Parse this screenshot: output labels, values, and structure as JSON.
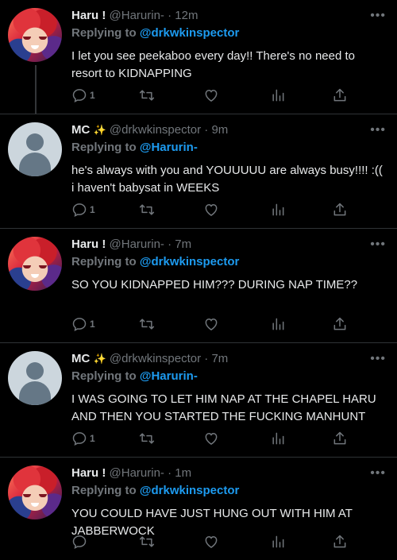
{
  "tweets": [
    {
      "name": "Haru !",
      "name_suffix": "",
      "handle": "@Harurin-",
      "time": "12m",
      "replying_label": "Replying to",
      "replying_handle": "@drkwkinspector",
      "text": "I let you see peekaboo every day!! There's no need to resort to KIDNAPPING",
      "reply_count": "1",
      "avatar": "haru"
    },
    {
      "name": "MC",
      "name_suffix": "✨",
      "handle": "@drkwkinspector",
      "time": "9m",
      "replying_label": "Replying to",
      "replying_handle": "@Harurin-",
      "text": "he's always with you and YOUUUUU are always busy!!!! :(( i haven't babysat in WEEKS",
      "reply_count": "1",
      "avatar": "mc"
    },
    {
      "name": "Haru !",
      "name_suffix": "",
      "handle": "@Harurin-",
      "time": "7m",
      "replying_label": "Replying to",
      "replying_handle": "@drkwkinspector",
      "text": "SO YOU KIDNAPPED HIM??? DURING NAP TIME??",
      "reply_count": "1",
      "avatar": "haru"
    },
    {
      "name": "MC",
      "name_suffix": "✨",
      "handle": "@drkwkinspector",
      "time": "7m",
      "replying_label": "Replying to",
      "replying_handle": "@Harurin-",
      "text": "I WAS GOING TO LET HIM NAP AT THE CHAPEL HARU AND THEN YOU STARTED THE FUCKING MANHUNT",
      "reply_count": "1",
      "avatar": "mc"
    },
    {
      "name": "Haru !",
      "name_suffix": "",
      "handle": "@Harurin-",
      "time": "1m",
      "replying_label": "Replying to",
      "replying_handle": "@drkwkinspector",
      "text": "YOU COULD HAVE JUST HUNG OUT WITH HIM AT JABBERWOCK",
      "reply_count": "",
      "avatar": "haru"
    }
  ],
  "separator": "·",
  "more_glyph": "•••",
  "icons": {
    "reply": "reply-icon",
    "retweet": "retweet-icon",
    "like": "heart-icon",
    "views": "analytics-icon",
    "share": "share-icon"
  },
  "colors": {
    "background": "#000000",
    "link": "#1d9bf0",
    "muted": "#71767b",
    "text": "#e7e9ea"
  }
}
